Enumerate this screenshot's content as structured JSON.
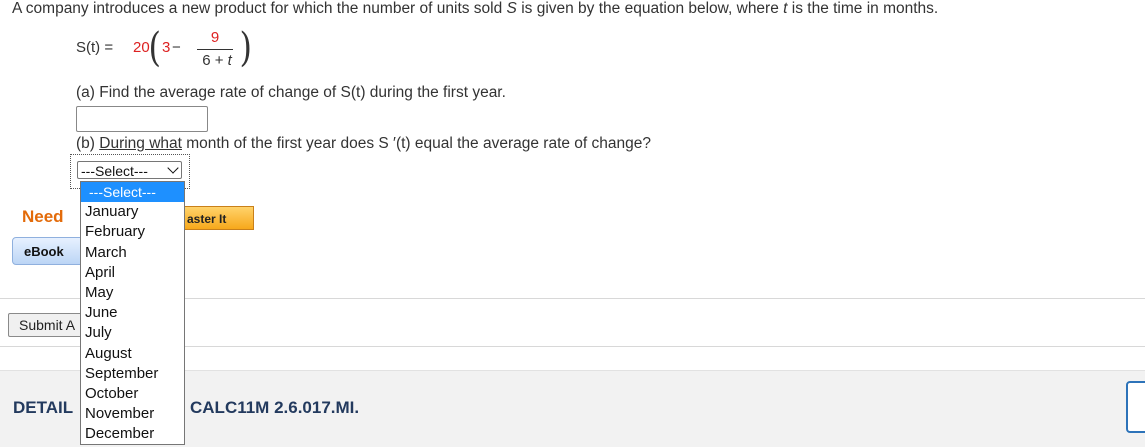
{
  "question": {
    "intro_a": "A company introduces a new product for which the number of units sold ",
    "var_s": "S",
    "intro_b": " is given by the equation below, where ",
    "var_t": "t",
    "intro_c": " is the time in months."
  },
  "equation": {
    "lhs": "S(t) = ",
    "coef": "20",
    "three": "3",
    "minus": " − ",
    "numerator": "9",
    "denominator_a": "6 + ",
    "denominator_t": "t"
  },
  "part_a": {
    "label": "(a) Find the average rate of change of S(t) during the first year.",
    "answer_value": ""
  },
  "part_b": {
    "label_prefix": "(b) ",
    "label_underlined": "During what",
    "label_rest": " month of the first year does S ′(t) equal the average rate of change?"
  },
  "select": {
    "current": "---Select---",
    "options": [
      "---Select---",
      "January",
      "February",
      "March",
      "April",
      "May",
      "June",
      "July",
      "August",
      "September",
      "October",
      "November",
      "December"
    ]
  },
  "help": {
    "need_text": "Need",
    "master_label": "aster It",
    "ebook_label": "eBook"
  },
  "submit_label": "Submit A",
  "details": {
    "label": "DETAIL",
    "code": "CALC11M 2.6.017.MI."
  }
}
